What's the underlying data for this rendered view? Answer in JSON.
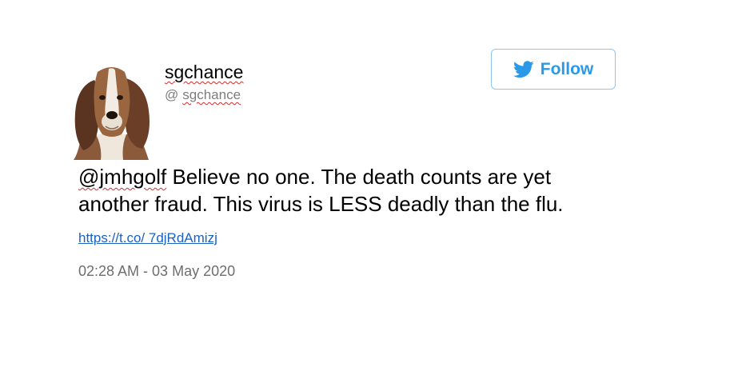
{
  "tweet": {
    "display_name": "sgchance",
    "handle_at": "@",
    "handle": "sgchance",
    "follow_label": "Follow",
    "mention": "@jmhgolf",
    "text_line1": " Believe no one.  The death counts are yet",
    "text_line2": "another fraud. This virus is LESS deadly than the flu.",
    "link": "https://t.co/ 7djRdAmizj",
    "timestamp": "02:28 AM - 03 May 2020"
  },
  "icons": {
    "avatar": "basset-hound-avatar",
    "follow": "twitter-bird-icon"
  },
  "colors": {
    "accent": "#2a9ae8",
    "button_border": "#8fc6ef",
    "link": "#1b62c4",
    "muted": "#7d7d7d",
    "spellcheck": "#d62d2d"
  }
}
